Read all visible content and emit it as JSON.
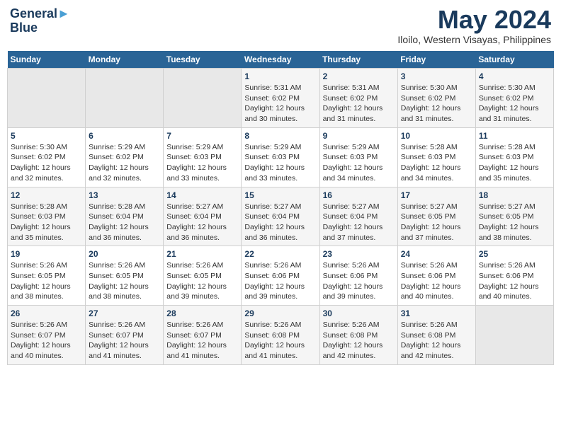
{
  "header": {
    "logo": {
      "line1": "General",
      "line2": "Blue"
    },
    "title": "May 2024",
    "location": "Iloilo, Western Visayas, Philippines"
  },
  "days_of_week": [
    "Sunday",
    "Monday",
    "Tuesday",
    "Wednesday",
    "Thursday",
    "Friday",
    "Saturday"
  ],
  "weeks": [
    [
      {
        "day": "",
        "sunrise": "",
        "sunset": "",
        "daylight": ""
      },
      {
        "day": "",
        "sunrise": "",
        "sunset": "",
        "daylight": ""
      },
      {
        "day": "",
        "sunrise": "",
        "sunset": "",
        "daylight": ""
      },
      {
        "day": "1",
        "sunrise": "Sunrise: 5:31 AM",
        "sunset": "Sunset: 6:02 PM",
        "daylight": "Daylight: 12 hours and 30 minutes."
      },
      {
        "day": "2",
        "sunrise": "Sunrise: 5:31 AM",
        "sunset": "Sunset: 6:02 PM",
        "daylight": "Daylight: 12 hours and 31 minutes."
      },
      {
        "day": "3",
        "sunrise": "Sunrise: 5:30 AM",
        "sunset": "Sunset: 6:02 PM",
        "daylight": "Daylight: 12 hours and 31 minutes."
      },
      {
        "day": "4",
        "sunrise": "Sunrise: 5:30 AM",
        "sunset": "Sunset: 6:02 PM",
        "daylight": "Daylight: 12 hours and 31 minutes."
      }
    ],
    [
      {
        "day": "5",
        "sunrise": "Sunrise: 5:30 AM",
        "sunset": "Sunset: 6:02 PM",
        "daylight": "Daylight: 12 hours and 32 minutes."
      },
      {
        "day": "6",
        "sunrise": "Sunrise: 5:29 AM",
        "sunset": "Sunset: 6:02 PM",
        "daylight": "Daylight: 12 hours and 32 minutes."
      },
      {
        "day": "7",
        "sunrise": "Sunrise: 5:29 AM",
        "sunset": "Sunset: 6:03 PM",
        "daylight": "Daylight: 12 hours and 33 minutes."
      },
      {
        "day": "8",
        "sunrise": "Sunrise: 5:29 AM",
        "sunset": "Sunset: 6:03 PM",
        "daylight": "Daylight: 12 hours and 33 minutes."
      },
      {
        "day": "9",
        "sunrise": "Sunrise: 5:29 AM",
        "sunset": "Sunset: 6:03 PM",
        "daylight": "Daylight: 12 hours and 34 minutes."
      },
      {
        "day": "10",
        "sunrise": "Sunrise: 5:28 AM",
        "sunset": "Sunset: 6:03 PM",
        "daylight": "Daylight: 12 hours and 34 minutes."
      },
      {
        "day": "11",
        "sunrise": "Sunrise: 5:28 AM",
        "sunset": "Sunset: 6:03 PM",
        "daylight": "Daylight: 12 hours and 35 minutes."
      }
    ],
    [
      {
        "day": "12",
        "sunrise": "Sunrise: 5:28 AM",
        "sunset": "Sunset: 6:03 PM",
        "daylight": "Daylight: 12 hours and 35 minutes."
      },
      {
        "day": "13",
        "sunrise": "Sunrise: 5:28 AM",
        "sunset": "Sunset: 6:04 PM",
        "daylight": "Daylight: 12 hours and 36 minutes."
      },
      {
        "day": "14",
        "sunrise": "Sunrise: 5:27 AM",
        "sunset": "Sunset: 6:04 PM",
        "daylight": "Daylight: 12 hours and 36 minutes."
      },
      {
        "day": "15",
        "sunrise": "Sunrise: 5:27 AM",
        "sunset": "Sunset: 6:04 PM",
        "daylight": "Daylight: 12 hours and 36 minutes."
      },
      {
        "day": "16",
        "sunrise": "Sunrise: 5:27 AM",
        "sunset": "Sunset: 6:04 PM",
        "daylight": "Daylight: 12 hours and 37 minutes."
      },
      {
        "day": "17",
        "sunrise": "Sunrise: 5:27 AM",
        "sunset": "Sunset: 6:05 PM",
        "daylight": "Daylight: 12 hours and 37 minutes."
      },
      {
        "day": "18",
        "sunrise": "Sunrise: 5:27 AM",
        "sunset": "Sunset: 6:05 PM",
        "daylight": "Daylight: 12 hours and 38 minutes."
      }
    ],
    [
      {
        "day": "19",
        "sunrise": "Sunrise: 5:26 AM",
        "sunset": "Sunset: 6:05 PM",
        "daylight": "Daylight: 12 hours and 38 minutes."
      },
      {
        "day": "20",
        "sunrise": "Sunrise: 5:26 AM",
        "sunset": "Sunset: 6:05 PM",
        "daylight": "Daylight: 12 hours and 38 minutes."
      },
      {
        "day": "21",
        "sunrise": "Sunrise: 5:26 AM",
        "sunset": "Sunset: 6:05 PM",
        "daylight": "Daylight: 12 hours and 39 minutes."
      },
      {
        "day": "22",
        "sunrise": "Sunrise: 5:26 AM",
        "sunset": "Sunset: 6:06 PM",
        "daylight": "Daylight: 12 hours and 39 minutes."
      },
      {
        "day": "23",
        "sunrise": "Sunrise: 5:26 AM",
        "sunset": "Sunset: 6:06 PM",
        "daylight": "Daylight: 12 hours and 39 minutes."
      },
      {
        "day": "24",
        "sunrise": "Sunrise: 5:26 AM",
        "sunset": "Sunset: 6:06 PM",
        "daylight": "Daylight: 12 hours and 40 minutes."
      },
      {
        "day": "25",
        "sunrise": "Sunrise: 5:26 AM",
        "sunset": "Sunset: 6:06 PM",
        "daylight": "Daylight: 12 hours and 40 minutes."
      }
    ],
    [
      {
        "day": "26",
        "sunrise": "Sunrise: 5:26 AM",
        "sunset": "Sunset: 6:07 PM",
        "daylight": "Daylight: 12 hours and 40 minutes."
      },
      {
        "day": "27",
        "sunrise": "Sunrise: 5:26 AM",
        "sunset": "Sunset: 6:07 PM",
        "daylight": "Daylight: 12 hours and 41 minutes."
      },
      {
        "day": "28",
        "sunrise": "Sunrise: 5:26 AM",
        "sunset": "Sunset: 6:07 PM",
        "daylight": "Daylight: 12 hours and 41 minutes."
      },
      {
        "day": "29",
        "sunrise": "Sunrise: 5:26 AM",
        "sunset": "Sunset: 6:08 PM",
        "daylight": "Daylight: 12 hours and 41 minutes."
      },
      {
        "day": "30",
        "sunrise": "Sunrise: 5:26 AM",
        "sunset": "Sunset: 6:08 PM",
        "daylight": "Daylight: 12 hours and 42 minutes."
      },
      {
        "day": "31",
        "sunrise": "Sunrise: 5:26 AM",
        "sunset": "Sunset: 6:08 PM",
        "daylight": "Daylight: 12 hours and 42 minutes."
      },
      {
        "day": "",
        "sunrise": "",
        "sunset": "",
        "daylight": ""
      }
    ]
  ]
}
